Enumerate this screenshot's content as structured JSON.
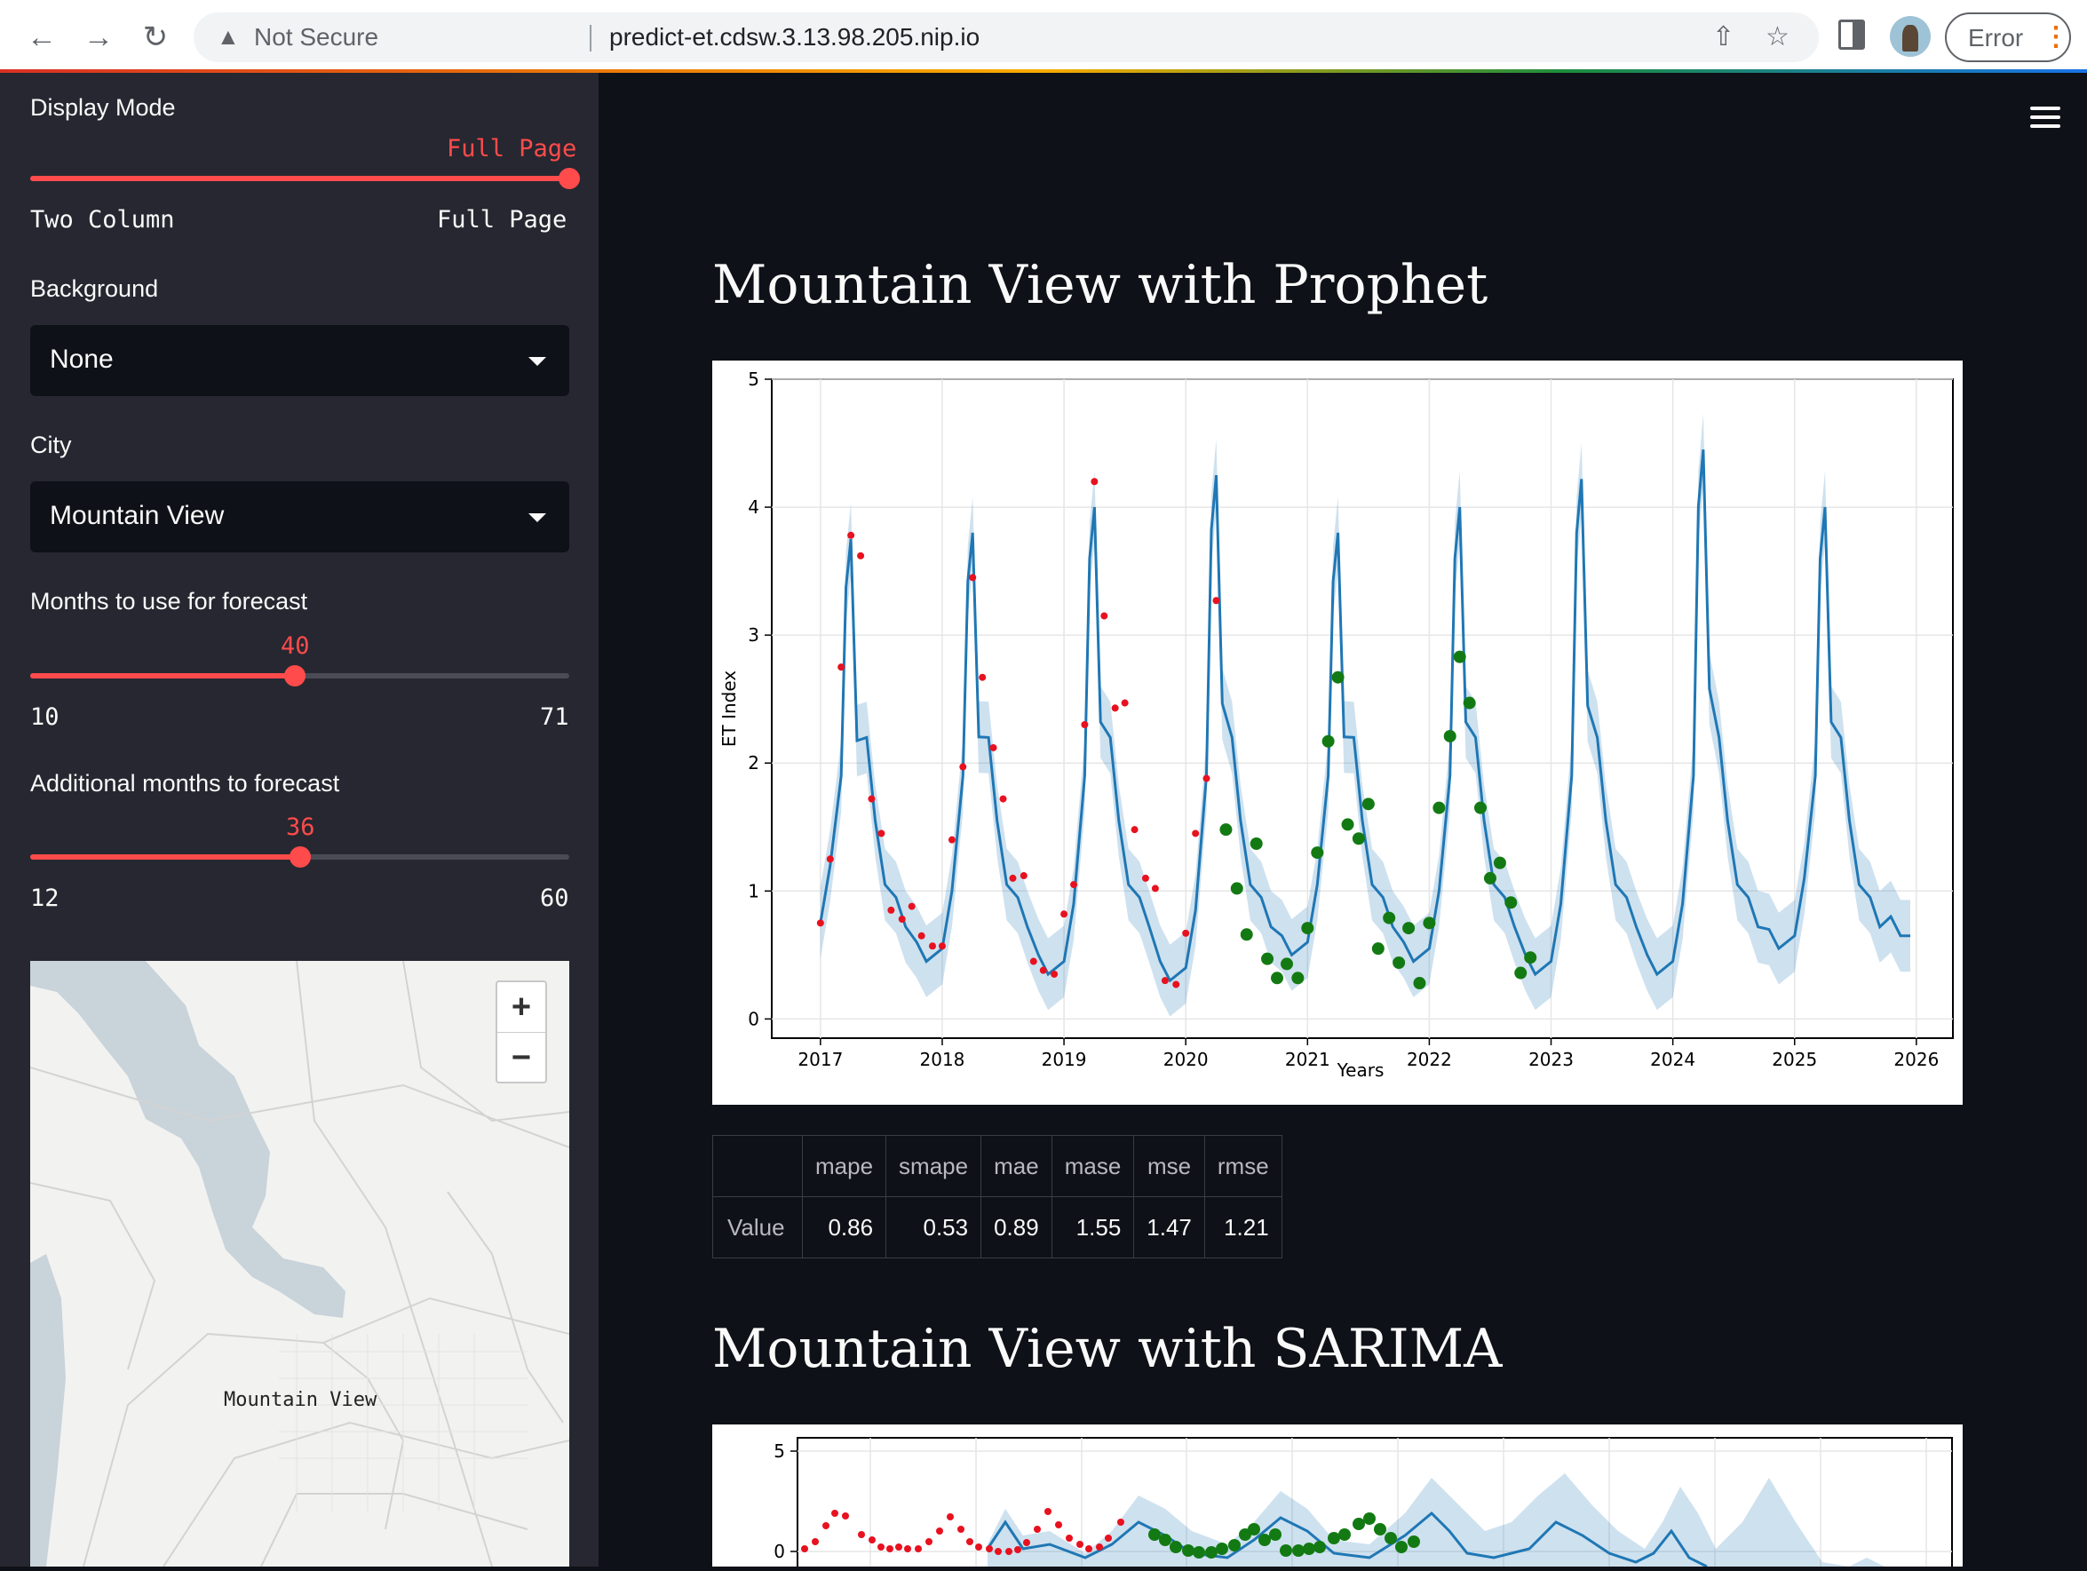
{
  "browser": {
    "security_label": "Not Secure",
    "url": "predict-et.cdsw.3.13.98.205.nip.io",
    "profile_button": "Error",
    "back_icon": "arrow-left-icon",
    "forward_icon": "arrow-right-icon",
    "reload_icon": "reload-icon"
  },
  "sidebar": {
    "display_mode": {
      "label": "Display Mode",
      "value": "Full Page",
      "options": [
        "Two Column",
        "Full Page"
      ]
    },
    "background": {
      "label": "Background",
      "value": "None"
    },
    "city": {
      "label": "City",
      "value": "Mountain View"
    },
    "months_forecast": {
      "label": "Months to use for forecast",
      "value": "40",
      "min": "10",
      "max": "71"
    },
    "additional_months": {
      "label": "Additional months to forecast",
      "value": "36",
      "min": "12",
      "max": "60"
    },
    "map": {
      "city_label": "Mountain View",
      "zoom_in": "+",
      "zoom_out": "−"
    }
  },
  "main": {
    "prophet_title": "Mountain View with Prophet",
    "sarima_title": "Mountain View with SARIMA",
    "metrics": {
      "headers": [
        "mape",
        "smape",
        "mae",
        "mase",
        "mse",
        "rmse"
      ],
      "row_label": "Value",
      "values": [
        "0.86",
        "0.53",
        "0.89",
        "1.55",
        "1.47",
        "1.21"
      ]
    }
  },
  "colors": {
    "accent": "#ff4b4b",
    "forecast_line": "#1f77b4",
    "train": "#e8111f",
    "test": "#137a13"
  },
  "chart_data": [
    {
      "type": "line",
      "xlabel": "Years",
      "ylabel": "ET Index",
      "xlim": [
        2016.6,
        2026.3
      ],
      "ylim": [
        -0.15,
        5.0
      ],
      "xticks": [
        "2017",
        "2018",
        "2019",
        "2020",
        "2021",
        "2022",
        "2023",
        "2024",
        "2025",
        "2026"
      ],
      "yticks": [
        "0",
        "1",
        "2",
        "3",
        "4",
        "5"
      ],
      "grid": true,
      "forecast_peaks": [
        3.75,
        3.8,
        4.0,
        4.25,
        3.8,
        4.0,
        4.22,
        4.45,
        4.0
      ],
      "forecast_troughs": [
        0.45,
        0.35,
        0.3,
        0.5,
        0.45,
        0.35,
        0.35,
        0.55,
        0.65
      ],
      "train_points": [
        [
          2017.0,
          0.75
        ],
        [
          2017.08,
          1.25
        ],
        [
          2017.17,
          2.75
        ],
        [
          2017.25,
          3.78
        ],
        [
          2017.33,
          3.62
        ],
        [
          2017.42,
          1.72
        ],
        [
          2017.5,
          1.45
        ],
        [
          2017.58,
          0.85
        ],
        [
          2017.67,
          0.78
        ],
        [
          2017.75,
          0.88
        ],
        [
          2017.83,
          0.65
        ],
        [
          2017.92,
          0.57
        ],
        [
          2018.0,
          0.57
        ],
        [
          2018.08,
          1.4
        ],
        [
          2018.17,
          1.97
        ],
        [
          2018.25,
          3.45
        ],
        [
          2018.33,
          2.67
        ],
        [
          2018.42,
          2.12
        ],
        [
          2018.5,
          1.72
        ],
        [
          2018.58,
          1.1
        ],
        [
          2018.67,
          1.12
        ],
        [
          2018.75,
          0.45
        ],
        [
          2018.83,
          0.38
        ],
        [
          2018.92,
          0.35
        ],
        [
          2019.0,
          0.82
        ],
        [
          2019.08,
          1.05
        ],
        [
          2019.17,
          2.3
        ],
        [
          2019.25,
          4.2
        ],
        [
          2019.33,
          3.15
        ],
        [
          2019.42,
          2.43
        ],
        [
          2019.5,
          2.47
        ],
        [
          2019.58,
          1.48
        ],
        [
          2019.67,
          1.1
        ],
        [
          2019.75,
          1.02
        ],
        [
          2019.83,
          0.3
        ],
        [
          2019.92,
          0.27
        ],
        [
          2020.0,
          0.67
        ],
        [
          2020.08,
          1.45
        ],
        [
          2020.17,
          1.88
        ],
        [
          2020.25,
          3.27
        ]
      ],
      "test_points": [
        [
          2020.33,
          1.48
        ],
        [
          2020.42,
          1.02
        ],
        [
          2020.5,
          0.66
        ],
        [
          2020.58,
          1.37
        ],
        [
          2020.67,
          0.47
        ],
        [
          2020.75,
          0.32
        ],
        [
          2020.83,
          0.43
        ],
        [
          2020.92,
          0.32
        ],
        [
          2021.0,
          0.71
        ],
        [
          2021.08,
          1.3
        ],
        [
          2021.17,
          2.17
        ],
        [
          2021.25,
          2.67
        ],
        [
          2021.33,
          1.52
        ],
        [
          2021.42,
          1.41
        ],
        [
          2021.5,
          1.68
        ],
        [
          2021.58,
          0.55
        ],
        [
          2021.67,
          0.79
        ],
        [
          2021.75,
          0.44
        ],
        [
          2021.83,
          0.71
        ],
        [
          2021.92,
          0.28
        ],
        [
          2022.0,
          0.75
        ],
        [
          2022.08,
          1.65
        ],
        [
          2022.17,
          2.21
        ],
        [
          2022.25,
          2.83
        ],
        [
          2022.33,
          2.47
        ],
        [
          2022.42,
          1.65
        ],
        [
          2022.5,
          1.1
        ],
        [
          2022.58,
          1.22
        ],
        [
          2022.67,
          0.91
        ],
        [
          2022.75,
          0.36
        ],
        [
          2022.83,
          0.48
        ]
      ]
    },
    {
      "type": "line",
      "yticks": [
        "5",
        "0"
      ],
      "ylim": [
        0,
        5
      ],
      "grid": true
    }
  ]
}
